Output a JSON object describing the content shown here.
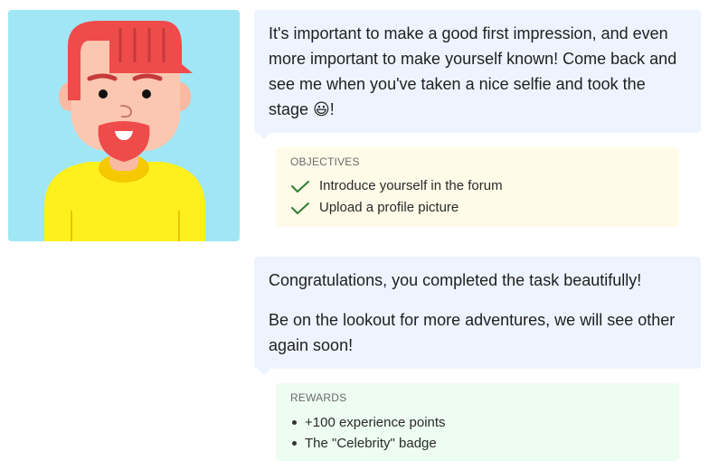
{
  "avatar": {
    "icon": "bearded-man-avatar-icon",
    "background": "#a0e6f5"
  },
  "messages": [
    {
      "paragraphs": [
        "It's important to make a good first impression, and even more important to make yourself known! Come back and see me when you've taken a nice selfie and took the stage 😃!"
      ]
    },
    {
      "paragraphs": [
        "Congratulations, you completed the task beautifully!",
        "Be on the lookout for more adventures, we will see other again soon!"
      ]
    }
  ],
  "objectives": {
    "title": "OBJECTIVES",
    "items": [
      {
        "label": "Introduce yourself in the forum",
        "icon": "check-icon",
        "done": true
      },
      {
        "label": "Upload a profile picture",
        "icon": "check-icon",
        "done": true
      }
    ],
    "check_color": "#2e7d32"
  },
  "rewards": {
    "title": "REWARDS",
    "items": [
      {
        "label": "+100 experience points"
      },
      {
        "label": "The \"Celebrity\" badge"
      }
    ]
  },
  "colors": {
    "bubble_bg": "#edf4ff",
    "objectives_bg": "#fffbe8",
    "rewards_bg": "#edfdf1"
  }
}
